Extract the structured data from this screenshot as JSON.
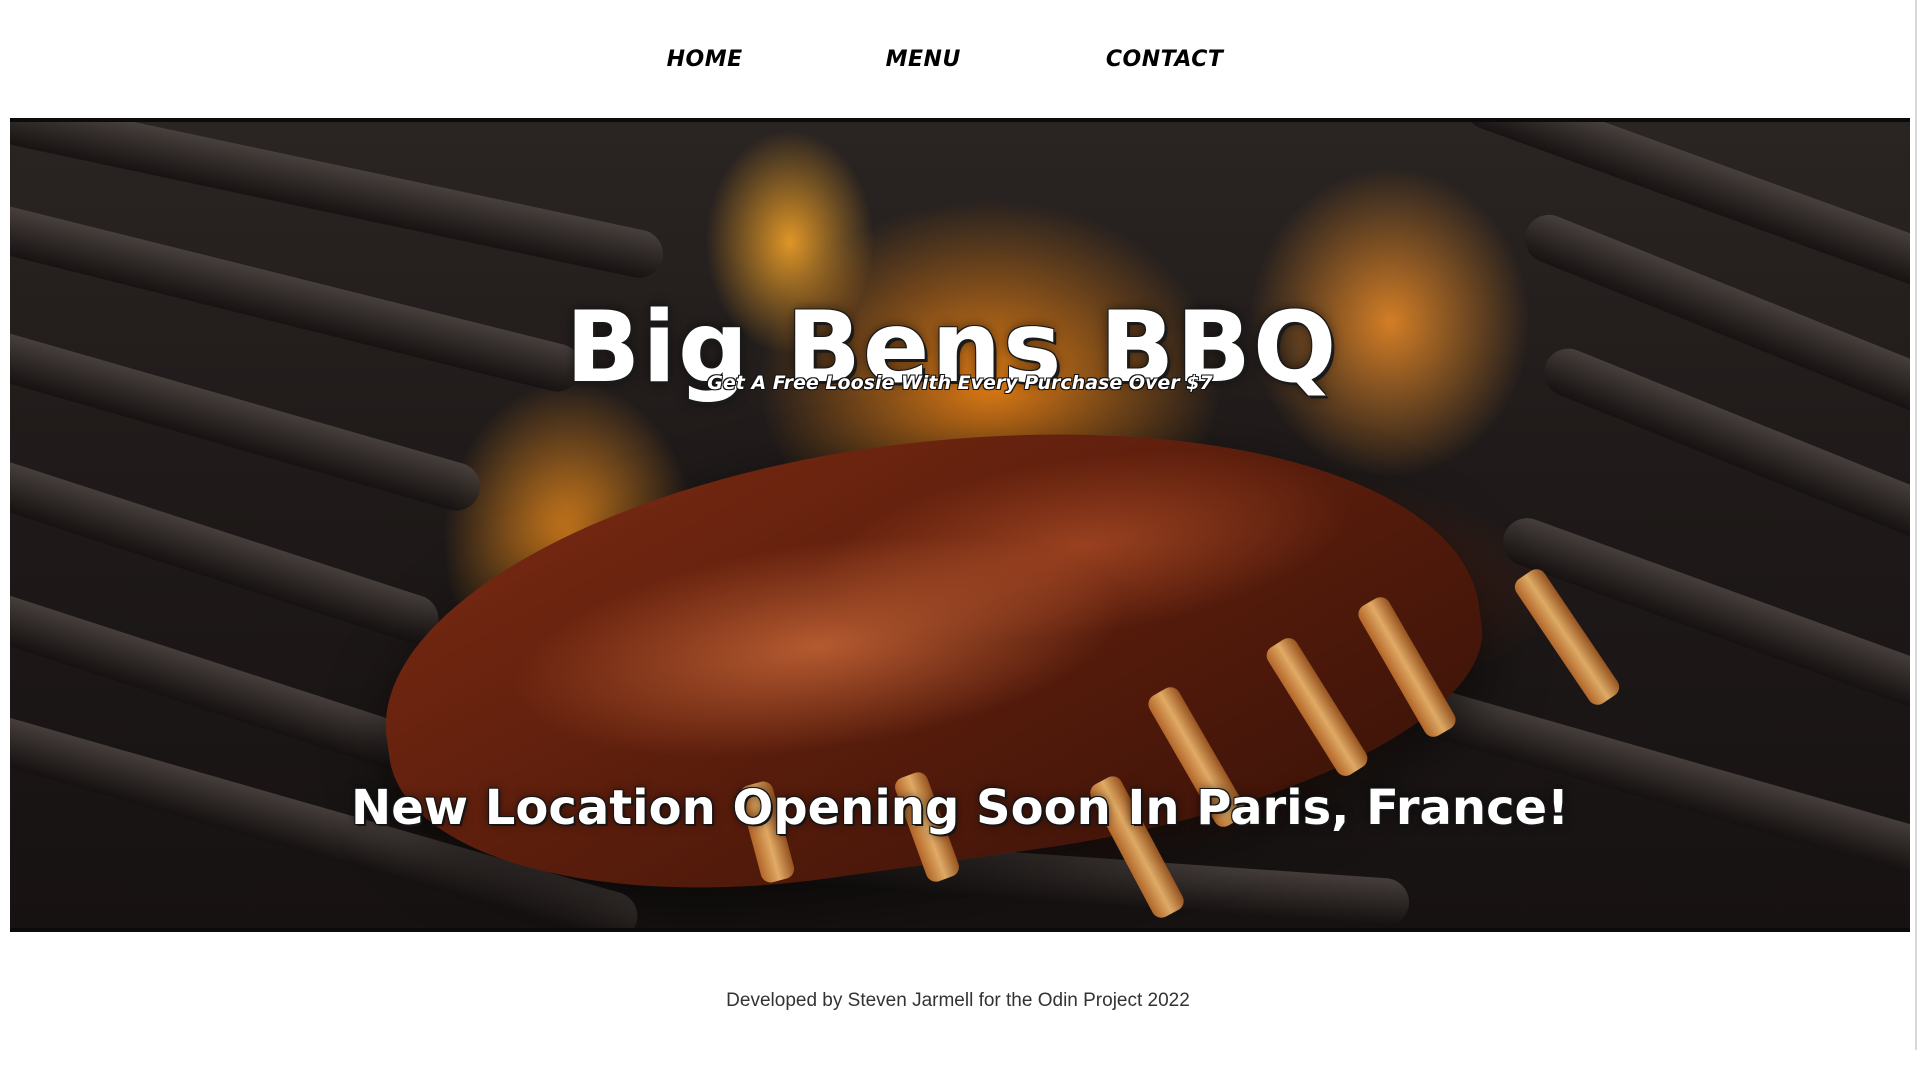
{
  "nav": {
    "items": [
      {
        "label": "HOME"
      },
      {
        "label": "MENU"
      },
      {
        "label": "CONTACT"
      }
    ]
  },
  "hero": {
    "title": "Big Bens BBQ",
    "tagline": "Get A Free Loosie With Every Purchase Over $7",
    "announcement": "New Location Opening Soon In Paris, France!",
    "image_subject": "glazed-ribs-on-flaming-grill"
  },
  "footer": {
    "credit": "Developed by Steven Jarmell for the Odin Project 2022"
  },
  "colors": {
    "background": "#ffffff",
    "nav_text": "#000000",
    "hero_text": "#ffffff",
    "hero_border": "#0b0b0b",
    "footer_text": "#333333",
    "flame": "#ff8c14",
    "sauce": "#7a2a12"
  }
}
